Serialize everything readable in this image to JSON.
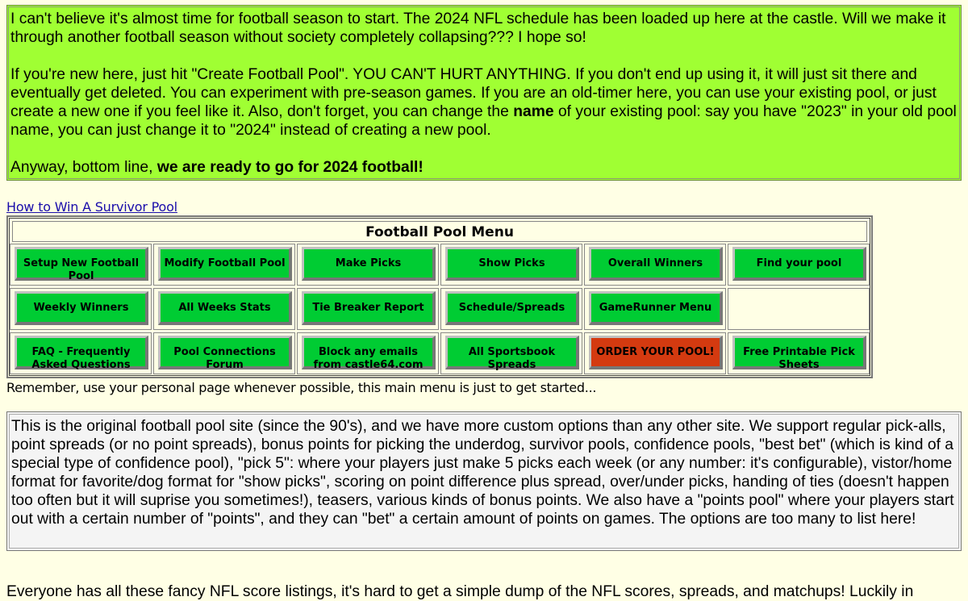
{
  "intro": {
    "p1": "I can't believe it's almost time for football season to start. The 2024 NFL schedule has been loaded up here at the castle. Will we make it through another football season without society completely collapsing??? I hope so!",
    "p2_before": "If you're new here, just hit \"Create Football Pool\". YOU CAN'T HURT ANYTHING. If you don't end up using it, it will just sit there and eventually get deleted. You can experiment with pre-season games. If you are an old-timer here, you can use your existing pool, or just create a new one if you feel like it. Also, don't forget, you can change the ",
    "p2_bold": "name",
    "p2_after": " of your existing pool: say you have \"2023\" in your old pool name, you can just change it to \"2024\" instead of creating a new pool.",
    "p3_before": "Anyway, bottom line, ",
    "p3_bold": "we are ready to go for 2024 football!"
  },
  "survivor_link": "How to Win A Survivor Pool",
  "menu": {
    "title": "Football Pool Menu",
    "rows": [
      [
        "Setup New Football Pool",
        "Modify Football Pool",
        "Make Picks",
        "Show Picks",
        "Overall Winners",
        "Find your pool"
      ],
      [
        "Weekly Winners",
        "All Weeks Stats",
        "Tie Breaker Report",
        "Schedule/Spreads",
        "GameRunner Menu",
        ""
      ],
      [
        "FAQ - Frequently Asked Questions",
        "Pool Connections Forum",
        "Block any emails from castle64.com",
        "All Sportsbook Spreads",
        "ORDER YOUR POOL!",
        "Free Printable Pick Sheets"
      ]
    ],
    "colors": {
      "button": "#00cc33",
      "order_button": "#d43a10"
    }
  },
  "remember_text": "Remember, use your personal page whenever possible, this main menu is just to get started...",
  "options_text": "This is the original football pool site (since the 90's), and we have more custom options than any other site. We support regular pick-alls, point spreads (or no point spreads), bonus points for picking the underdog, survivor pools, confidence pools, \"best bet\" (which is kind of a special type of confidence pool), \"pick 5\": where your players just make 5 picks each week (or any number: it's configurable), vistor/home format for favorite/dog format for \"show picks\", scoring on point difference plus spread, over/under picks, handing of ties (doesn't happen too often but it will suprise you sometimes!), teasers, various kinds of bonus points. We also have a \"points pool\" where your players start out with a certain number of \"points\", and they can \"bet\" a certain amount of points on games. The options are too many to list here!",
  "bottom_text": "Everyone has all these fancy NFL score listings, it's hard to get a simple dump of the NFL scores, spreads, and matchups! Luckily in"
}
